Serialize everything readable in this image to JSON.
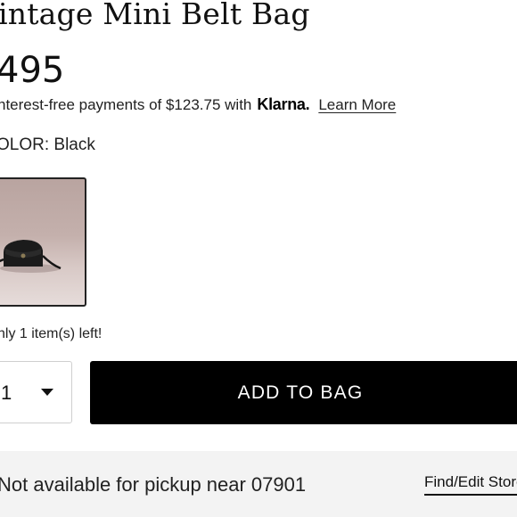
{
  "product": {
    "title": "intage Mini Belt Bag",
    "price": "495"
  },
  "payments": {
    "text": "nterest-free payments of $123.75 with",
    "klarna_logo": "Klarna.",
    "learn_more": "Learn More"
  },
  "color": {
    "label": "OLOR:",
    "value": "Black",
    "swatch_icon": "black-mini-belt-bag-photo"
  },
  "stock": {
    "text": "nly 1 item(s) left!"
  },
  "quantity": {
    "value": "1"
  },
  "add_to_bag": {
    "label": "ADD TO BAG"
  },
  "pickup": {
    "text": "Not available for pickup near 07901",
    "link": "Find/Edit Store"
  },
  "colors": {
    "button_bg": "#000000",
    "pickup_bg": "#f3f3f3"
  }
}
